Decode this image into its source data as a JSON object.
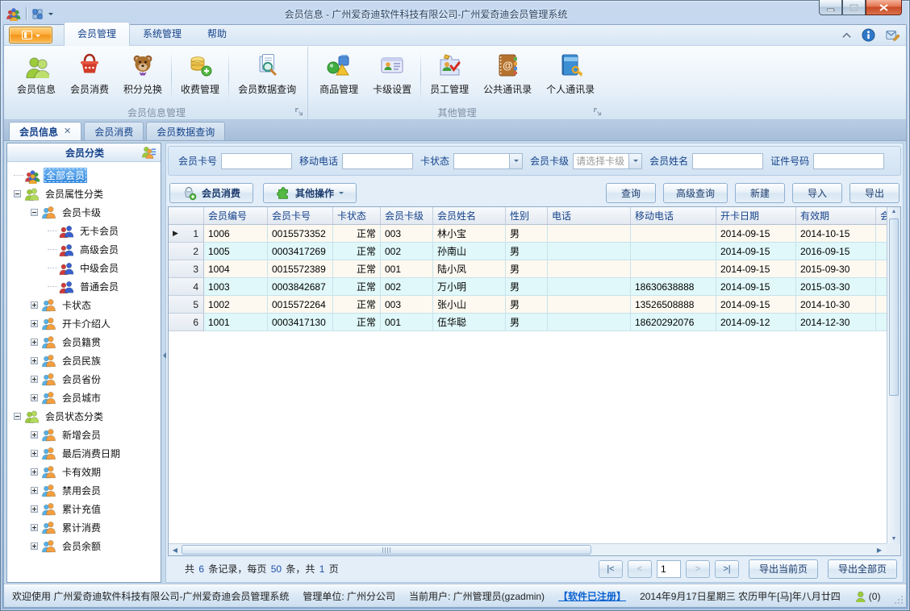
{
  "window": {
    "title": "会员信息 - 广州爱奇迪软件科技有限公司-广州爱奇迪会员管理系统"
  },
  "ribbon": {
    "tabs": [
      {
        "id": "member-management",
        "label": "会员管理",
        "active": true
      },
      {
        "id": "system-management",
        "label": "系统管理",
        "active": false
      },
      {
        "id": "help",
        "label": "帮助",
        "active": false
      }
    ],
    "groups": [
      {
        "label": "会员信息管理",
        "items": [
          {
            "id": "member-info",
            "label": "会员信息",
            "icon": "members"
          },
          {
            "id": "member-consume",
            "label": "会员消费",
            "icon": "basket"
          },
          {
            "id": "points-exchange",
            "label": "积分兑换",
            "icon": "teddy"
          },
          {
            "id": "fee-management",
            "label": "收费管理",
            "icon": "coins",
            "sep_before": true
          },
          {
            "id": "member-data-query",
            "label": "会员数据查询",
            "icon": "docsearch",
            "sep_before": true
          }
        ]
      },
      {
        "label": "其他管理",
        "items": [
          {
            "id": "product-management",
            "label": "商品管理",
            "icon": "shapes"
          },
          {
            "id": "card-level-settings",
            "label": "卡级设置",
            "icon": "idcard"
          },
          {
            "id": "employee-management",
            "label": "员工管理",
            "icon": "employee",
            "sep_before": true
          },
          {
            "id": "public-contacts",
            "label": "公共通讯录",
            "icon": "abook"
          },
          {
            "id": "personal-contacts",
            "label": "个人通讯录",
            "icon": "bookkey"
          }
        ]
      }
    ]
  },
  "doc_tabs": [
    {
      "id": "member-info",
      "label": "会员信息",
      "active": true,
      "closable": true
    },
    {
      "id": "member-consume",
      "label": "会员消费",
      "active": false,
      "closable": false
    },
    {
      "id": "member-data-query",
      "label": "会员数据查询",
      "active": false,
      "closable": false
    }
  ],
  "sidebar": {
    "header": "会员分类",
    "tree": [
      {
        "id": "all-members",
        "label": "全部会员",
        "level": 0,
        "expander": "none",
        "icon": "group",
        "selected": true
      },
      {
        "id": "attr-category",
        "label": "会员属性分类",
        "level": 0,
        "expander": "minus",
        "icon": "pair-green"
      },
      {
        "id": "card-level",
        "label": "会员卡级",
        "level": 1,
        "expander": "minus",
        "icon": "pair-orange"
      },
      {
        "id": "no-card-member",
        "label": "无卡会员",
        "level": 2,
        "expander": "none",
        "icon": "couple"
      },
      {
        "id": "senior-member",
        "label": "高级会员",
        "level": 2,
        "expander": "none",
        "icon": "couple"
      },
      {
        "id": "middle-member",
        "label": "中级会员",
        "level": 2,
        "expander": "none",
        "icon": "couple"
      },
      {
        "id": "normal-member",
        "label": "普通会员",
        "level": 2,
        "expander": "none",
        "icon": "couple"
      },
      {
        "id": "card-status",
        "label": "卡状态",
        "level": 1,
        "expander": "plus",
        "icon": "pair-orange"
      },
      {
        "id": "card-introducer",
        "label": "开卡介绍人",
        "level": 1,
        "expander": "plus",
        "icon": "pair-orange"
      },
      {
        "id": "member-origin",
        "label": "会员籍贯",
        "level": 1,
        "expander": "plus",
        "icon": "pair-orange"
      },
      {
        "id": "member-ethnic",
        "label": "会员民族",
        "level": 1,
        "expander": "plus",
        "icon": "pair-orange"
      },
      {
        "id": "member-province",
        "label": "会员省份",
        "level": 1,
        "expander": "plus",
        "icon": "pair-orange"
      },
      {
        "id": "member-city",
        "label": "会员城市",
        "level": 1,
        "expander": "plus",
        "icon": "pair-orange"
      },
      {
        "id": "status-category",
        "label": "会员状态分类",
        "level": 0,
        "expander": "minus",
        "icon": "pair-green"
      },
      {
        "id": "new-members",
        "label": "新增会员",
        "level": 1,
        "expander": "plus",
        "icon": "pair-orange"
      },
      {
        "id": "last-consume-date",
        "label": "最后消费日期",
        "level": 1,
        "expander": "plus",
        "icon": "pair-orange"
      },
      {
        "id": "card-validity",
        "label": "卡有效期",
        "level": 1,
        "expander": "plus",
        "icon": "pair-orange"
      },
      {
        "id": "disabled-members",
        "label": "禁用会员",
        "level": 1,
        "expander": "plus",
        "icon": "pair-orange"
      },
      {
        "id": "total-recharge",
        "label": "累计充值",
        "level": 1,
        "expander": "plus",
        "icon": "pair-orange"
      },
      {
        "id": "total-consume",
        "label": "累计消费",
        "level": 1,
        "expander": "plus",
        "icon": "pair-orange"
      },
      {
        "id": "member-balance",
        "label": "会员余额",
        "level": 1,
        "expander": "plus",
        "icon": "pair-orange"
      }
    ]
  },
  "filters": [
    {
      "id": "card-no",
      "label": "会员卡号",
      "type": "input",
      "value": ""
    },
    {
      "id": "mobile",
      "label": "移动电话",
      "type": "input",
      "value": ""
    },
    {
      "id": "card-status",
      "label": "卡状态",
      "type": "combo",
      "value": ""
    },
    {
      "id": "card-level",
      "label": "会员卡级",
      "type": "combo",
      "value": "请选择卡级"
    },
    {
      "id": "member-name",
      "label": "会员姓名",
      "type": "input",
      "value": ""
    },
    {
      "id": "id-number",
      "label": "证件号码",
      "type": "input",
      "value": ""
    }
  ],
  "toolbar": {
    "left": [
      {
        "id": "member-consume",
        "label": "会员消费",
        "icon": "basket-add"
      },
      {
        "id": "other-actions",
        "label": "其他操作",
        "icon": "puzzle",
        "dropdown": true
      }
    ],
    "right": [
      {
        "id": "query",
        "label": "查询"
      },
      {
        "id": "advanced-query",
        "label": "高级查询"
      },
      {
        "id": "new",
        "label": "新建"
      },
      {
        "id": "import",
        "label": "导入"
      },
      {
        "id": "export",
        "label": "导出"
      }
    ]
  },
  "grid": {
    "columns": [
      "",
      "会员编号",
      "会员卡号",
      "卡状态",
      "会员卡级",
      "会员姓名",
      "性别",
      "电话",
      "移动电话",
      "开卡日期",
      "有效期",
      "会员"
    ],
    "rows": [
      {
        "num": "1",
        "current": true,
        "cells": [
          "1006",
          "0015573352",
          "正常",
          "003",
          "林小宝",
          "男",
          "",
          "",
          "2014-09-15",
          "2014-10-15",
          ""
        ]
      },
      {
        "num": "2",
        "current": false,
        "cells": [
          "1005",
          "0003417269",
          "正常",
          "002",
          "孙南山",
          "男",
          "",
          "",
          "2014-09-15",
          "2016-09-15",
          ""
        ]
      },
      {
        "num": "3",
        "current": false,
        "cells": [
          "1004",
          "0015572389",
          "正常",
          "001",
          "陆小凤",
          "男",
          "",
          "",
          "2014-09-15",
          "2015-09-30",
          ""
        ]
      },
      {
        "num": "4",
        "current": false,
        "cells": [
          "1003",
          "0003842687",
          "正常",
          "002",
          "万小明",
          "男",
          "",
          "18630638888",
          "2014-09-15",
          "2015-03-30",
          ""
        ]
      },
      {
        "num": "5",
        "current": false,
        "cells": [
          "1002",
          "0015572264",
          "正常",
          "003",
          "张小山",
          "男",
          "",
          "13526508888",
          "2014-09-15",
          "2014-10-30",
          ""
        ]
      },
      {
        "num": "6",
        "current": false,
        "cells": [
          "1001",
          "0003417130",
          "正常",
          "001",
          "伍华聪",
          "男",
          "",
          "18620292076",
          "2014-09-12",
          "2014-12-30",
          ""
        ]
      }
    ]
  },
  "pager": {
    "summary_parts": [
      "共 ",
      "6",
      " 条记录，每页 ",
      "50",
      " 条，共 ",
      "1",
      " 页"
    ],
    "nav": [
      {
        "id": "first-page",
        "label": "|<",
        "dim": false
      },
      {
        "id": "prev-page",
        "label": "<",
        "dim": true
      }
    ],
    "page_value": "1",
    "nav_after": [
      {
        "id": "next-page",
        "label": ">",
        "dim": true
      },
      {
        "id": "last-page",
        "label": ">|",
        "dim": false
      }
    ],
    "export_current": "导出当前页",
    "export_all": "导出全部页"
  },
  "statusbar": {
    "welcome": "欢迎使用 广州爱奇迪软件科技有限公司-广州爱奇迪会员管理系统",
    "unit": "管理单位: 广州分公司",
    "user": "当前用户: 广州管理员(gzadmin)",
    "registered": "【软件已注册】",
    "date": "2014年9月17日星期三 农历甲午[马]年八月廿四",
    "messages": "(0)"
  }
}
